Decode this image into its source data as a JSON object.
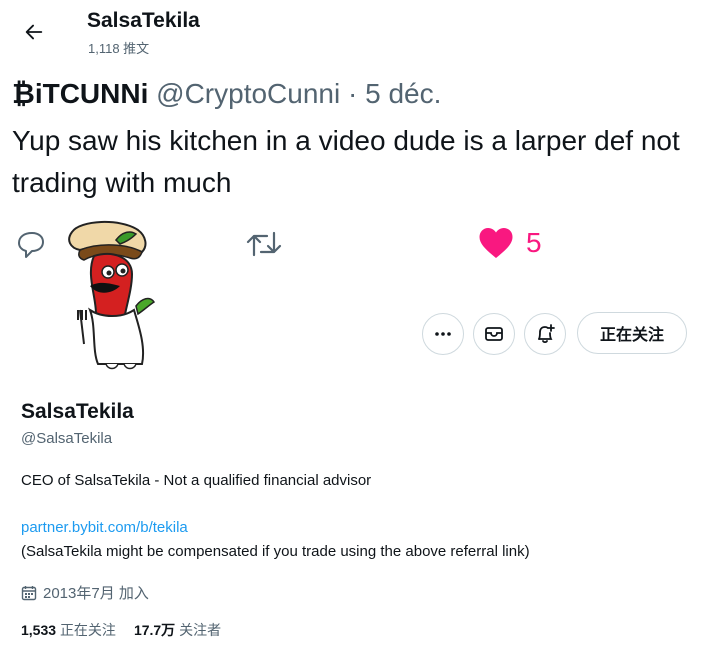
{
  "header": {
    "title": "SalsaTekila",
    "tweet_count": "1,118 推文"
  },
  "tweet": {
    "author_name": "₿iTCUNNi",
    "handle": "@CryptoCunni",
    "separator": " · ",
    "date": "5 déc.",
    "text": "Yup saw his kitchen in a video dude is a larper def not trading with much",
    "like_count": "5"
  },
  "profile_actions": {
    "follow_label": "正在关注"
  },
  "profile": {
    "name": "SalsaTekila",
    "handle": "@SalsaTekila",
    "bio": "CEO of SalsaTekila - Not a qualified financial advisor",
    "link": "partner.bybit.com/b/tekila",
    "note": "(SalsaTekila might be compensated if you trade using the above referral link)",
    "joined": "2013年7月 加入",
    "following_count": "1,533",
    "following_label": "正在关注",
    "followers_count": "17.7万",
    "followers_label": "关注者"
  },
  "colors": {
    "like": "#f91880",
    "link": "#1d9bf0",
    "muted": "#536471"
  },
  "icons": [
    "back-arrow-icon",
    "reply-icon",
    "retweet-icon",
    "heart-icon",
    "more-icon",
    "mail-icon",
    "notify-icon",
    "calendar-icon"
  ]
}
